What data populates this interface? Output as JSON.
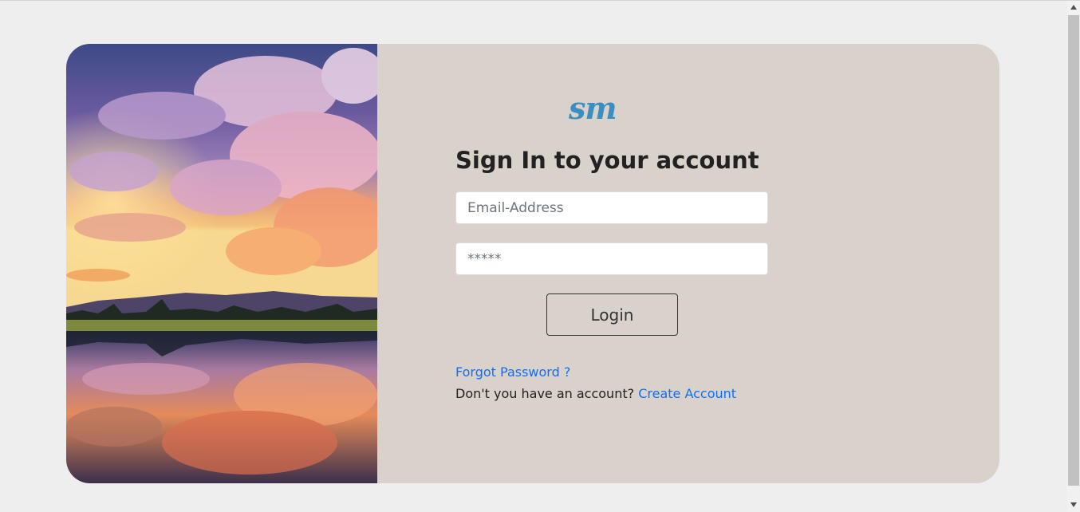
{
  "login": {
    "logo_text": "sm",
    "title": "Sign In to your account",
    "email": {
      "placeholder": "Email-Address",
      "value": ""
    },
    "password": {
      "placeholder": "*****",
      "value": ""
    },
    "login_button": "Login",
    "forgot_password": "Forgot Password ?",
    "no_account_text": "Don't you have an account?",
    "create_account": "Create Account"
  },
  "colors": {
    "page_bg": "#eeeeee",
    "card_bg": "#d9d2cb",
    "logo": "#3a8ec1",
    "link": "#0d6efd",
    "text": "#222222"
  },
  "icons": {
    "scroll_up": "triangle-up",
    "scroll_down": "triangle-down"
  }
}
